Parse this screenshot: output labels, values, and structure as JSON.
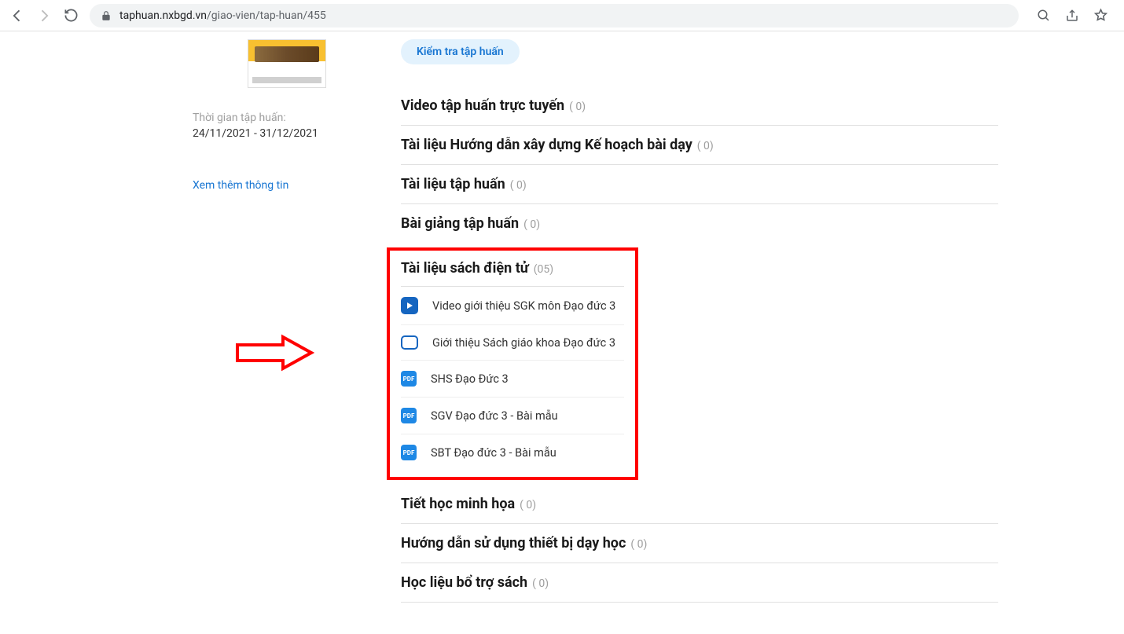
{
  "browser": {
    "url_domain": "taphuan.nxbgd.vn",
    "url_path": "/giao-vien/tap-huan/455"
  },
  "sidebar": {
    "time_label": "Thời gian tập huấn:",
    "time_value": "24/11/2021 - 31/12/2021",
    "more_info": "Xem thêm thông tin"
  },
  "pill": "Kiểm tra tập huấn",
  "sections": [
    {
      "title": "Video tập huấn trực tuyến",
      "count": "( 0)"
    },
    {
      "title": "Tài liệu Hướng dẫn xây dựng Kế hoạch bài dạy",
      "count": "( 0)"
    },
    {
      "title": "Tài liệu tập huấn",
      "count": "( 0)"
    },
    {
      "title": "Bài giảng tập huấn",
      "count": "( 0)"
    }
  ],
  "ebook_section": {
    "title": "Tài liệu sách điện tử",
    "count": "(05)",
    "items": [
      {
        "icon": "video",
        "label": "Video giới thiệu SGK môn Đạo đức 3"
      },
      {
        "icon": "slide",
        "label": "Giới thiệu Sách giáo khoa Đạo đức 3"
      },
      {
        "icon": "pdf",
        "label": "SHS Đạo Đức 3"
      },
      {
        "icon": "pdf",
        "label": "SGV Đạo đức 3 - Bài mẫu"
      },
      {
        "icon": "pdf",
        "label": "SBT Đạo đức 3 - Bài mẫu"
      }
    ]
  },
  "sections_after": [
    {
      "title": "Tiết học minh họa",
      "count": "( 0)"
    },
    {
      "title": "Hướng dẫn sử dụng thiết bị dạy học",
      "count": "( 0)"
    },
    {
      "title": "Học liệu bổ trợ sách",
      "count": "( 0)"
    }
  ],
  "pdf_badge": "PDF"
}
